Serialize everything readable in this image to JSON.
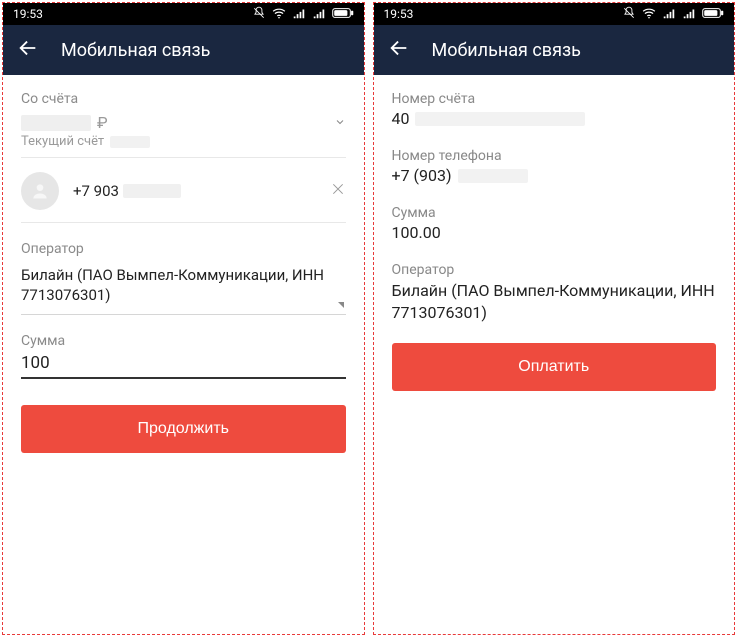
{
  "status": {
    "time": "19:53"
  },
  "appbar": {
    "title": "Мобильная связь"
  },
  "left": {
    "account_label": "Со счёта",
    "currency_sign": "₽",
    "account_type": "Текущий счёт",
    "phone_prefix": "+7 903",
    "operator_label": "Оператор",
    "operator_value": "Билайн (ПАО Вымпел-Коммуникации, ИНН 7713076301)",
    "sum_label": "Сумма",
    "sum_value": "100",
    "continue_btn": "Продолжить"
  },
  "right": {
    "account_label": "Номер счёта",
    "account_prefix": "40",
    "phone_label": "Номер телефона",
    "phone_prefix": "+7 (903)",
    "sum_label": "Сумма",
    "sum_value": "100.00",
    "operator_label": "Оператор",
    "operator_value": "Билайн (ПАО Вымпел-Коммуникации, ИНН 7713076301)",
    "pay_btn": "Оплатить"
  }
}
